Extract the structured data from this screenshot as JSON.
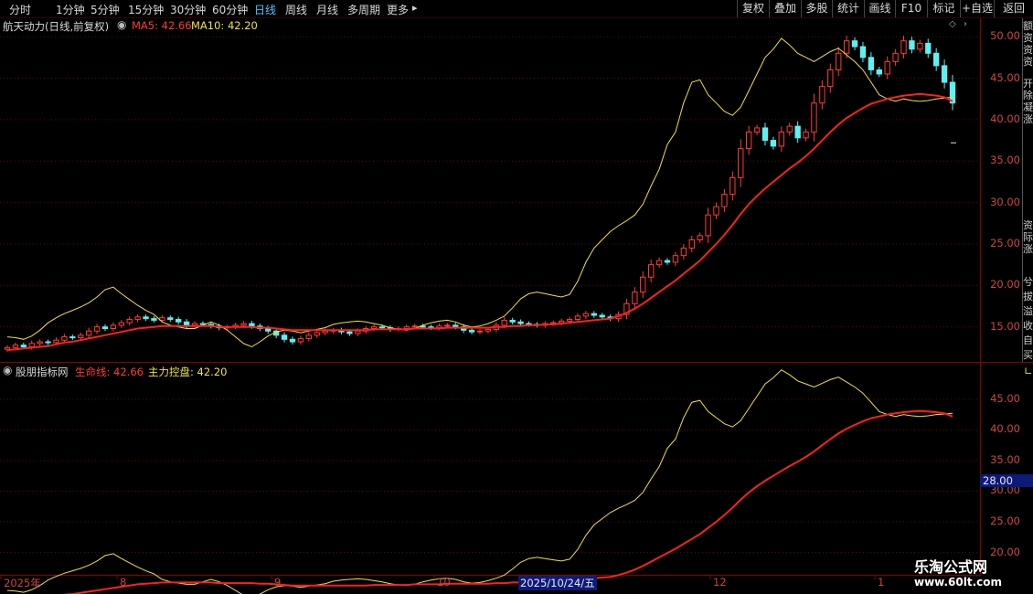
{
  "toolbar": {
    "left_tabs": [
      "分时",
      "1分钟",
      "5分钟",
      "15分钟",
      "30分钟",
      "60分钟",
      "日线",
      "周线",
      "月线",
      "多周期",
      "更多"
    ],
    "active_tab": "日线",
    "right_buttons": [
      "复权",
      "叠加",
      "多股",
      "统计",
      "画线",
      "F10",
      "标记",
      "+自选",
      "返回"
    ]
  },
  "main_panel": {
    "title": "航天动力(日线,前复权)",
    "ma5_label": "MA5: 42.66",
    "ma10_label": "MA10: 42.20",
    "ma5_color": "#ff3b3b",
    "ma10_color": "#f0e040"
  },
  "indicator_panel": {
    "title": "股朋指标网",
    "lifeline_label": "生命线: 42.66",
    "control_label": "主力控盘: 42.20",
    "cursor_value": "28.00"
  },
  "sidebar_text": [
    "额资资资",
    "开除凝涨",
    "资际涨",
    "兮",
    "拔",
    "溢",
    "收",
    "自",
    "买"
  ],
  "x_axis": {
    "labels": [
      "2025年",
      "8",
      "9",
      "10",
      "12",
      "1"
    ],
    "cursor_date": "2025/10/24/五"
  },
  "watermark": {
    "line1": "乐淘公式网",
    "line2": "www.60lt.com"
  },
  "chart_data": [
    {
      "type": "candlestick",
      "title": "航天动力(日线,前复权)",
      "ylim": [
        11.0,
        52.0
      ],
      "yticks": [
        15.0,
        20.0,
        25.0,
        30.0,
        35.0,
        40.0,
        45.0,
        50.0
      ],
      "colors": {
        "up": "#ff3b3b",
        "down": "#5ff0f0",
        "ma_red": "#ff2020",
        "ma_yellow": "#f0e040"
      },
      "closes": [
        12.5,
        12.8,
        12.6,
        13.0,
        13.2,
        13.1,
        13.4,
        13.8,
        13.7,
        14.0,
        14.5,
        15.0,
        14.8,
        15.2,
        15.5,
        15.9,
        16.2,
        16.0,
        15.8,
        16.1,
        15.9,
        15.6,
        15.2,
        15.4,
        15.3,
        15.1,
        14.9,
        15.0,
        15.2,
        15.4,
        15.1,
        14.8,
        14.5,
        14.0,
        13.5,
        13.2,
        13.6,
        14.0,
        14.3,
        14.5,
        14.6,
        14.4,
        14.2,
        14.5,
        14.8,
        15.0,
        14.9,
        14.7,
        14.8,
        15.0,
        15.1,
        15.0,
        14.9,
        15.1,
        15.2,
        15.0,
        14.6,
        14.4,
        14.5,
        14.7,
        15.2,
        15.8,
        15.6,
        15.4,
        15.3,
        15.2,
        15.4,
        15.5,
        15.7,
        15.9,
        16.3,
        16.6,
        16.4,
        16.2,
        16.0,
        16.5,
        17.8,
        19.2,
        21.0,
        22.5,
        23.0,
        22.8,
        23.6,
        24.5,
        25.5,
        26.0,
        28.5,
        29.5,
        31.0,
        33.0,
        36.5,
        38.5,
        39.0,
        37.5,
        36.8,
        38.5,
        39.2,
        37.8,
        38.5,
        42.0,
        44.0,
        46.0,
        48.0,
        49.5,
        48.8,
        47.5,
        46.0,
        45.5,
        47.0,
        48.0,
        49.5,
        48.5,
        49.2,
        48.0,
        46.5,
        44.5,
        42.0
      ],
      "ma_red": [
        12.2,
        12.3,
        12.4,
        12.5,
        12.6,
        12.7,
        12.9,
        13.1,
        13.2,
        13.4,
        13.6,
        13.8,
        14.0,
        14.2,
        14.4,
        14.6,
        14.8,
        14.9,
        15.0,
        15.1,
        15.1,
        15.1,
        15.1,
        15.1,
        15.1,
        15.1,
        15.0,
        15.0,
        15.0,
        15.0,
        15.0,
        14.9,
        14.9,
        14.8,
        14.7,
        14.6,
        14.6,
        14.6,
        14.6,
        14.6,
        14.6,
        14.6,
        14.6,
        14.6,
        14.6,
        14.7,
        14.7,
        14.7,
        14.7,
        14.7,
        14.8,
        14.8,
        14.8,
        14.8,
        14.9,
        14.9,
        14.9,
        14.9,
        14.9,
        14.9,
        15.0,
        15.0,
        15.1,
        15.1,
        15.2,
        15.2,
        15.3,
        15.3,
        15.4,
        15.5,
        15.6,
        15.7,
        15.8,
        15.9,
        16.0,
        16.3,
        16.7,
        17.2,
        17.8,
        18.5,
        19.2,
        19.9,
        20.6,
        21.4,
        22.2,
        23.0,
        24.0,
        25.0,
        26.1,
        27.3,
        28.6,
        29.8,
        30.8,
        31.7,
        32.5,
        33.3,
        34.1,
        34.8,
        35.6,
        36.5,
        37.5,
        38.5,
        39.4,
        40.2,
        40.8,
        41.4,
        41.9,
        42.2,
        42.5,
        42.7,
        42.9,
        43.0,
        43.1,
        43.0,
        42.9,
        42.7,
        42.2
      ],
      "ma_yellow": [
        13.8,
        13.7,
        13.5,
        13.9,
        14.6,
        15.5,
        16.1,
        16.6,
        17.0,
        17.4,
        17.9,
        18.6,
        19.5,
        19.8,
        19.0,
        18.3,
        17.6,
        17.0,
        16.5,
        15.6,
        15.2,
        15.0,
        14.8,
        14.8,
        15.2,
        15.6,
        15.2,
        14.6,
        13.8,
        13.0,
        12.6,
        13.2,
        13.9,
        14.4,
        14.6,
        14.5,
        14.3,
        14.5,
        14.7,
        14.9,
        15.3,
        15.5,
        15.6,
        15.7,
        15.6,
        15.4,
        15.2,
        14.9,
        14.7,
        14.6,
        14.8,
        15.2,
        15.5,
        15.7,
        15.8,
        15.6,
        15.2,
        15.0,
        15.1,
        15.4,
        15.8,
        16.3,
        17.3,
        18.4,
        19.0,
        19.2,
        19.0,
        18.8,
        18.6,
        18.9,
        20.5,
        22.8,
        24.5,
        25.5,
        26.5,
        27.2,
        27.8,
        28.5,
        29.8,
        32.0,
        34.0,
        37.0,
        38.5,
        42.0,
        44.5,
        44.8,
        43.0,
        42.0,
        41.0,
        40.5,
        41.5,
        43.5,
        45.5,
        47.5,
        48.5,
        49.8,
        49.0,
        48.0,
        47.5,
        47.0,
        47.6,
        48.2,
        48.6,
        47.8,
        47.0,
        46.0,
        44.5,
        43.0,
        42.5,
        42.2,
        42.5,
        42.3,
        42.2,
        42.3,
        42.5,
        42.6,
        42.7
      ]
    },
    {
      "type": "line",
      "title": "股朋指标网",
      "ylim": [
        16.5,
        50.5
      ],
      "yticks": [
        20.0,
        25.0,
        30.0,
        35.0,
        40.0,
        45.0
      ],
      "series": [
        {
          "name": "生命线",
          "color": "#ff2020"
        },
        {
          "name": "主力控盘",
          "color": "#f0e040"
        }
      ]
    }
  ]
}
